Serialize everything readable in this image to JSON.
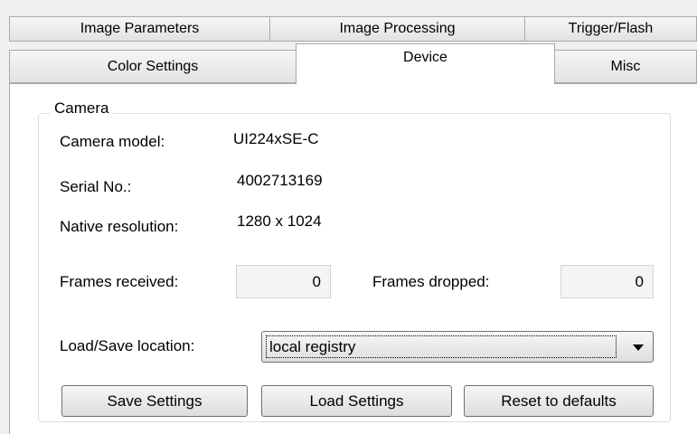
{
  "tabs": {
    "row1": [
      "Image Parameters",
      "Image Processing",
      "Trigger/Flash"
    ],
    "row2": [
      "Color Settings",
      "Device",
      "Misc"
    ],
    "active": "Device"
  },
  "camera": {
    "group_title": "Camera",
    "model_label": "Camera model:",
    "model_value": "UI224xSE-C",
    "serial_label": "Serial No.:",
    "serial_value": "4002713169",
    "resolution_label": "Native resolution:",
    "resolution_value": "1280 x 1024",
    "frames_received_label": "Frames received:",
    "frames_received_value": "0",
    "frames_dropped_label": "Frames dropped:",
    "frames_dropped_value": "0",
    "load_save_label": "Load/Save location:",
    "load_save_value": "local registry"
  },
  "buttons": {
    "save": "Save Settings",
    "load": "Load Settings",
    "reset": "Reset to defaults"
  },
  "icons": {
    "combo_arrow": "chevron-down-icon"
  }
}
